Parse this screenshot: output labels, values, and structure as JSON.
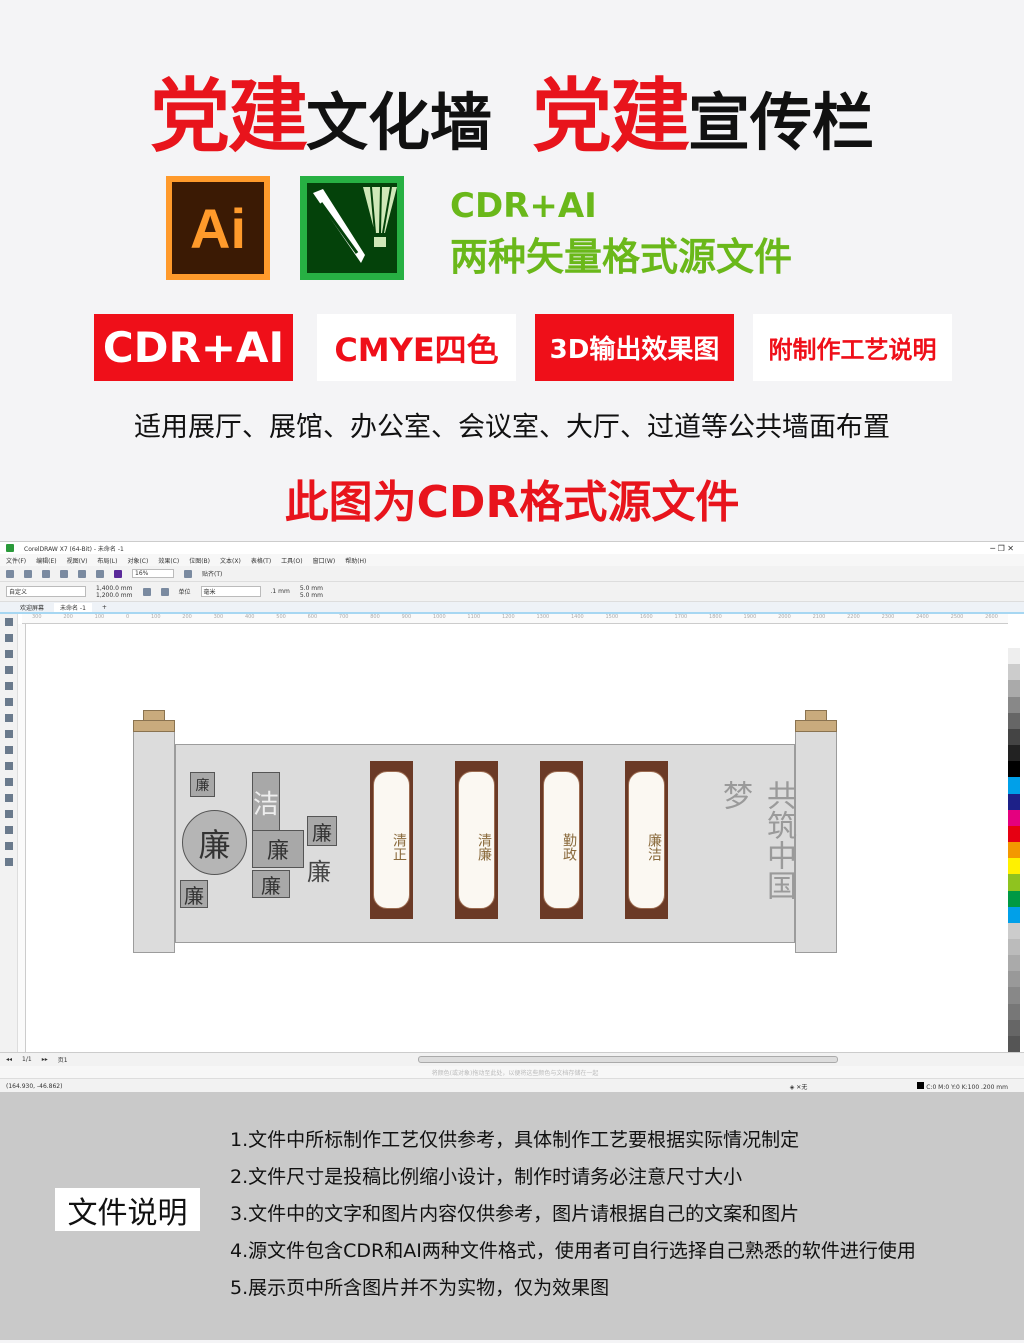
{
  "header": {
    "title_parts": [
      {
        "text": "党建",
        "accent": true
      },
      {
        "text": "文化墙",
        "accent": false
      },
      {
        "text": "党建",
        "accent": true
      },
      {
        "text": "宣传栏",
        "accent": false
      }
    ]
  },
  "logos": {
    "ai_label": "Ai",
    "ai_icon": "adobe-illustrator-icon",
    "cdr_icon": "coreldraw-icon"
  },
  "formats": {
    "line1": "CDR+AI",
    "line2": "两种矢量格式源文件"
  },
  "badges": [
    {
      "label": "CDR+AI",
      "style": "red"
    },
    {
      "label": "CMYE四色",
      "style": "white"
    },
    {
      "label": "3D输出效果图",
      "style": "red"
    },
    {
      "label": "附制作工艺说明",
      "style": "white"
    }
  ],
  "usage": "适用展厅、展馆、办公室、会议室、大厅、过道等公共墙面布置",
  "source_note": "此图为CDR格式源文件",
  "colors": {
    "red": "#e8141c",
    "green": "#6ab81a",
    "gray": "#c9c9c9"
  },
  "corel": {
    "title": "CorelDRAW X7 (64-Bit) - 未命名 -1",
    "menu": [
      "文件(F)",
      "编辑(E)",
      "视图(V)",
      "布局(L)",
      "对象(C)",
      "效果(C)",
      "位图(B)",
      "文本(X)",
      "表格(T)",
      "工具(O)",
      "窗口(W)",
      "帮助(H)"
    ],
    "zoom": "16%",
    "snap": "贴齐(T)",
    "preset": "自定义",
    "width": "1,400.0 mm",
    "height": "1,200.0 mm",
    "unit_label": "单位",
    "unit": "毫米",
    "nudge": ".1 mm",
    "dup_x": "5.0 mm",
    "dup_y": "5.0 mm",
    "tabs": [
      "欢迎屏幕",
      "未命名 -1"
    ],
    "ruler": [
      "300",
      "200",
      "100",
      "0",
      "100",
      "200",
      "300",
      "400",
      "500",
      "600",
      "700",
      "800",
      "900",
      "1000",
      "1100",
      "1200",
      "1300",
      "1400",
      "1500",
      "1600",
      "1700",
      "1800",
      "1900",
      "2000",
      "2100",
      "2200",
      "2300",
      "2400",
      "2500",
      "2600"
    ],
    "page_nav": "1/1",
    "page_tab": "页1",
    "hint": "将颜色(或对象)拖动至此处，以便将这些颜色与文档存储在一起",
    "coords": "(164.930, -46.862)",
    "fill": "无",
    "outline": "C:0 M:0 Y:0 K:100  .200 mm",
    "artwork": {
      "panels": [
        "清正",
        "清廉",
        "勤政",
        "廉洁"
      ],
      "slogan": "共筑中国梦",
      "lian": "廉",
      "jie": "洁"
    }
  },
  "notes": {
    "label": "文件说明",
    "items": [
      "1.文件中所标制作工艺仅供参考，具体制作工艺要根据实际情况制定",
      "2.文件尺寸是投稿比例缩小设计，制作时请务必注意尺寸大小",
      "3.文件中的文字和图片内容仅供参考，图片请根据自己的文案和图片",
      "4.源文件包含CDR和AI两种文件格式，使用者可自行选择自己熟悉的软件进行使用",
      "5.展示页中所含图片并不为实物，仅为效果图"
    ]
  }
}
